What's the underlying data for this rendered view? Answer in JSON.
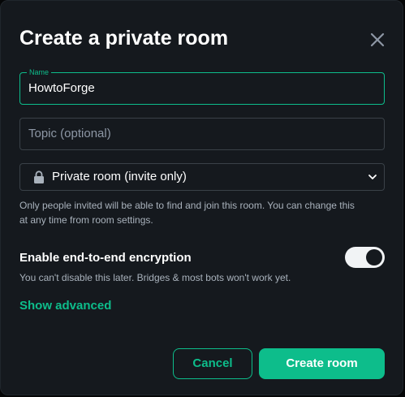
{
  "dialog": {
    "title": "Create a private room",
    "close_icon": "close-icon"
  },
  "name_field": {
    "label": "Name",
    "value": "HowtoForge"
  },
  "topic_field": {
    "placeholder": "Topic (optional)",
    "value": ""
  },
  "visibility": {
    "icon": "lock-icon",
    "selected": "Private room (invite only)",
    "help": "Only people invited will be able to find and join this room. You can change this at any time from room settings."
  },
  "encryption": {
    "label": "Enable end-to-end encryption",
    "help": "You can't disable this later. Bridges & most bots won't work yet.",
    "enabled": true
  },
  "advanced": {
    "label": "Show advanced"
  },
  "buttons": {
    "cancel": "Cancel",
    "create": "Create room"
  },
  "colors": {
    "accent": "#0dbd8b",
    "background": "#15191e",
    "border": "#3a4148",
    "text_secondary": "#a9b2bc"
  }
}
